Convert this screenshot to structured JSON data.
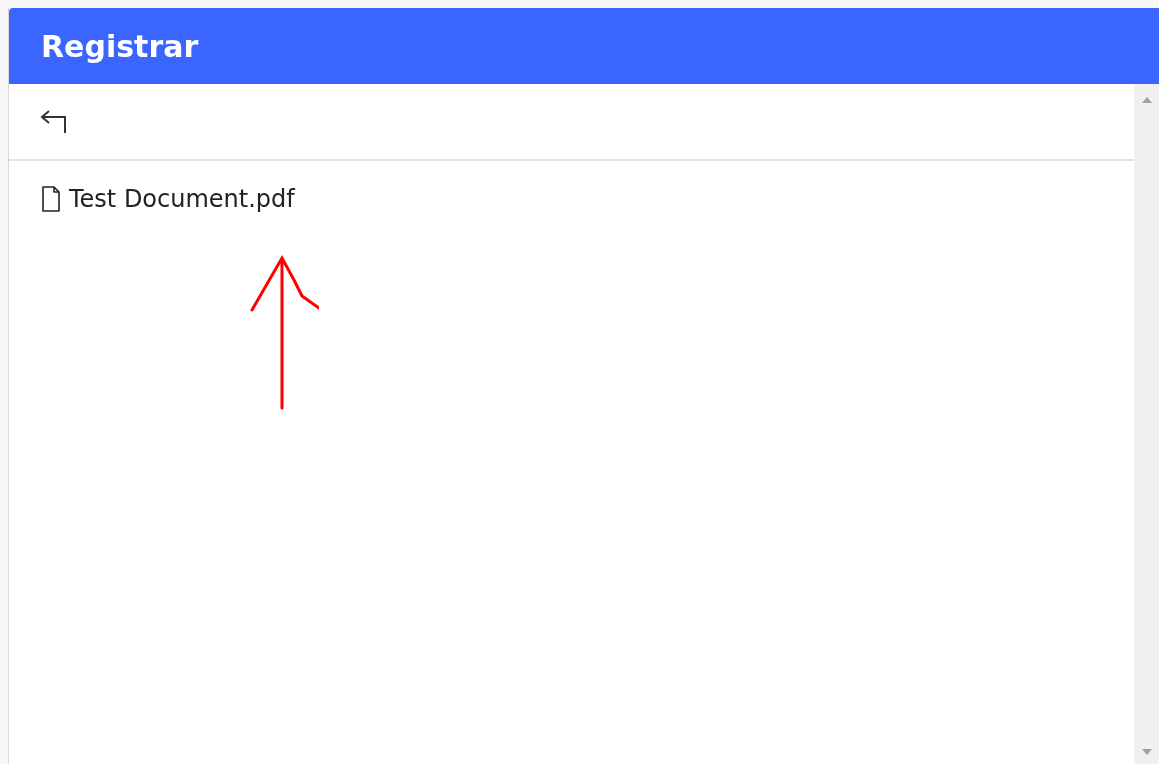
{
  "header": {
    "title": "Registrar"
  },
  "files": [
    {
      "name": "Test Document.pdf"
    }
  ]
}
